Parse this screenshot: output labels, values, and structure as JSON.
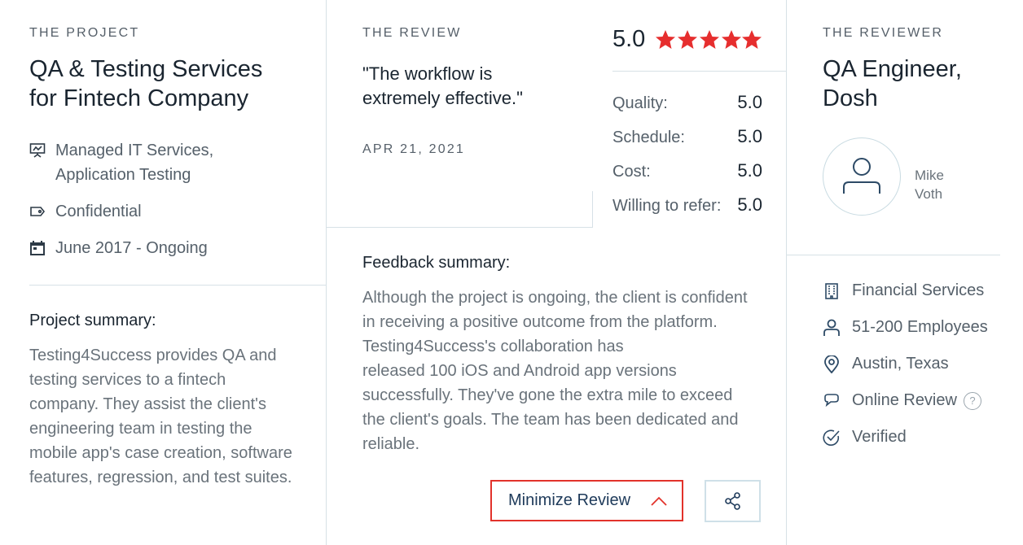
{
  "project": {
    "section_label": "THE PROJECT",
    "title_line1": "QA & Testing Services",
    "title_line2": "for Fintech Company",
    "services_line1": "Managed IT Services,",
    "services_line2": "Application Testing",
    "budget": "Confidential",
    "dates": "June 2017 - Ongoing",
    "summary_heading": "Project summary:",
    "summary_lines": [
      "Testing4Success provides QA and",
      "testing services to a fintech",
      "company. They assist the client's",
      "engineering team in testing the",
      "mobile app's case creation, software",
      "features, regression, and test suites."
    ]
  },
  "review": {
    "section_label": "THE REVIEW",
    "quote_line1": "\"The workflow is",
    "quote_line2": "extremely effective.\"",
    "date": "APR 21, 2021",
    "overall_rating": "5.0",
    "stars": 5,
    "ratings": [
      {
        "label": "Quality:",
        "value": "5.0"
      },
      {
        "label": "Schedule:",
        "value": "5.0"
      },
      {
        "label": "Cost:",
        "value": "5.0"
      },
      {
        "label": "Willing to refer:",
        "value": "5.0"
      }
    ],
    "feedback_heading": "Feedback summary:",
    "feedback_lines": [
      "Although the project is ongoing, the client is confident",
      "in receiving a positive outcome from the platform.",
      "Testing4Success's collaboration has",
      "released 100 iOS and Android app versions",
      "successfully. They've gone the extra mile to exceed",
      "the client's goals. The team has been dedicated and",
      "reliable."
    ],
    "minimize_label": "Minimize Review",
    "accent_color": "#e62e2e"
  },
  "reviewer": {
    "section_label": "THE REVIEWER",
    "title_line1": "QA Engineer,",
    "title_line2": "Dosh",
    "name_line1": "Mike",
    "name_line2": "Voth",
    "industry": "Financial Services",
    "size": "51-200 Employees",
    "location": "Austin, Texas",
    "review_type": "Online Review",
    "help_mark": "?",
    "verified": "Verified"
  }
}
